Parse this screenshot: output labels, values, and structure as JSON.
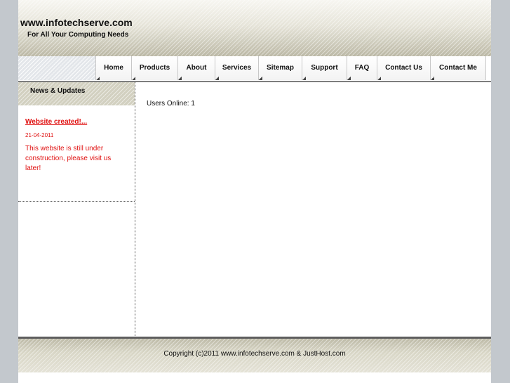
{
  "header": {
    "site_title": "www.infotechserve.com",
    "tagline": "For All Your Computing Needs"
  },
  "nav": {
    "items": [
      {
        "label": "Home"
      },
      {
        "label": "Products"
      },
      {
        "label": "About"
      },
      {
        "label": "Services"
      },
      {
        "label": "Sitemap"
      },
      {
        "label": "Support"
      },
      {
        "label": "FAQ"
      },
      {
        "label": "Contact Us"
      },
      {
        "label": "Contact Me"
      }
    ]
  },
  "sidebar": {
    "title": "News & Updates",
    "news": {
      "headline": "Website created!...",
      "date": "21-04-2011",
      "body": "This website is still under construction, please visit us later!"
    }
  },
  "main": {
    "users_online": "Users Online: 1"
  },
  "footer": {
    "copyright": "Copyright (c)2011 www.infotechserve.com & JustHost.com"
  },
  "colors": {
    "news_red": "#e01010",
    "page_bg": "#c3c8cd"
  }
}
